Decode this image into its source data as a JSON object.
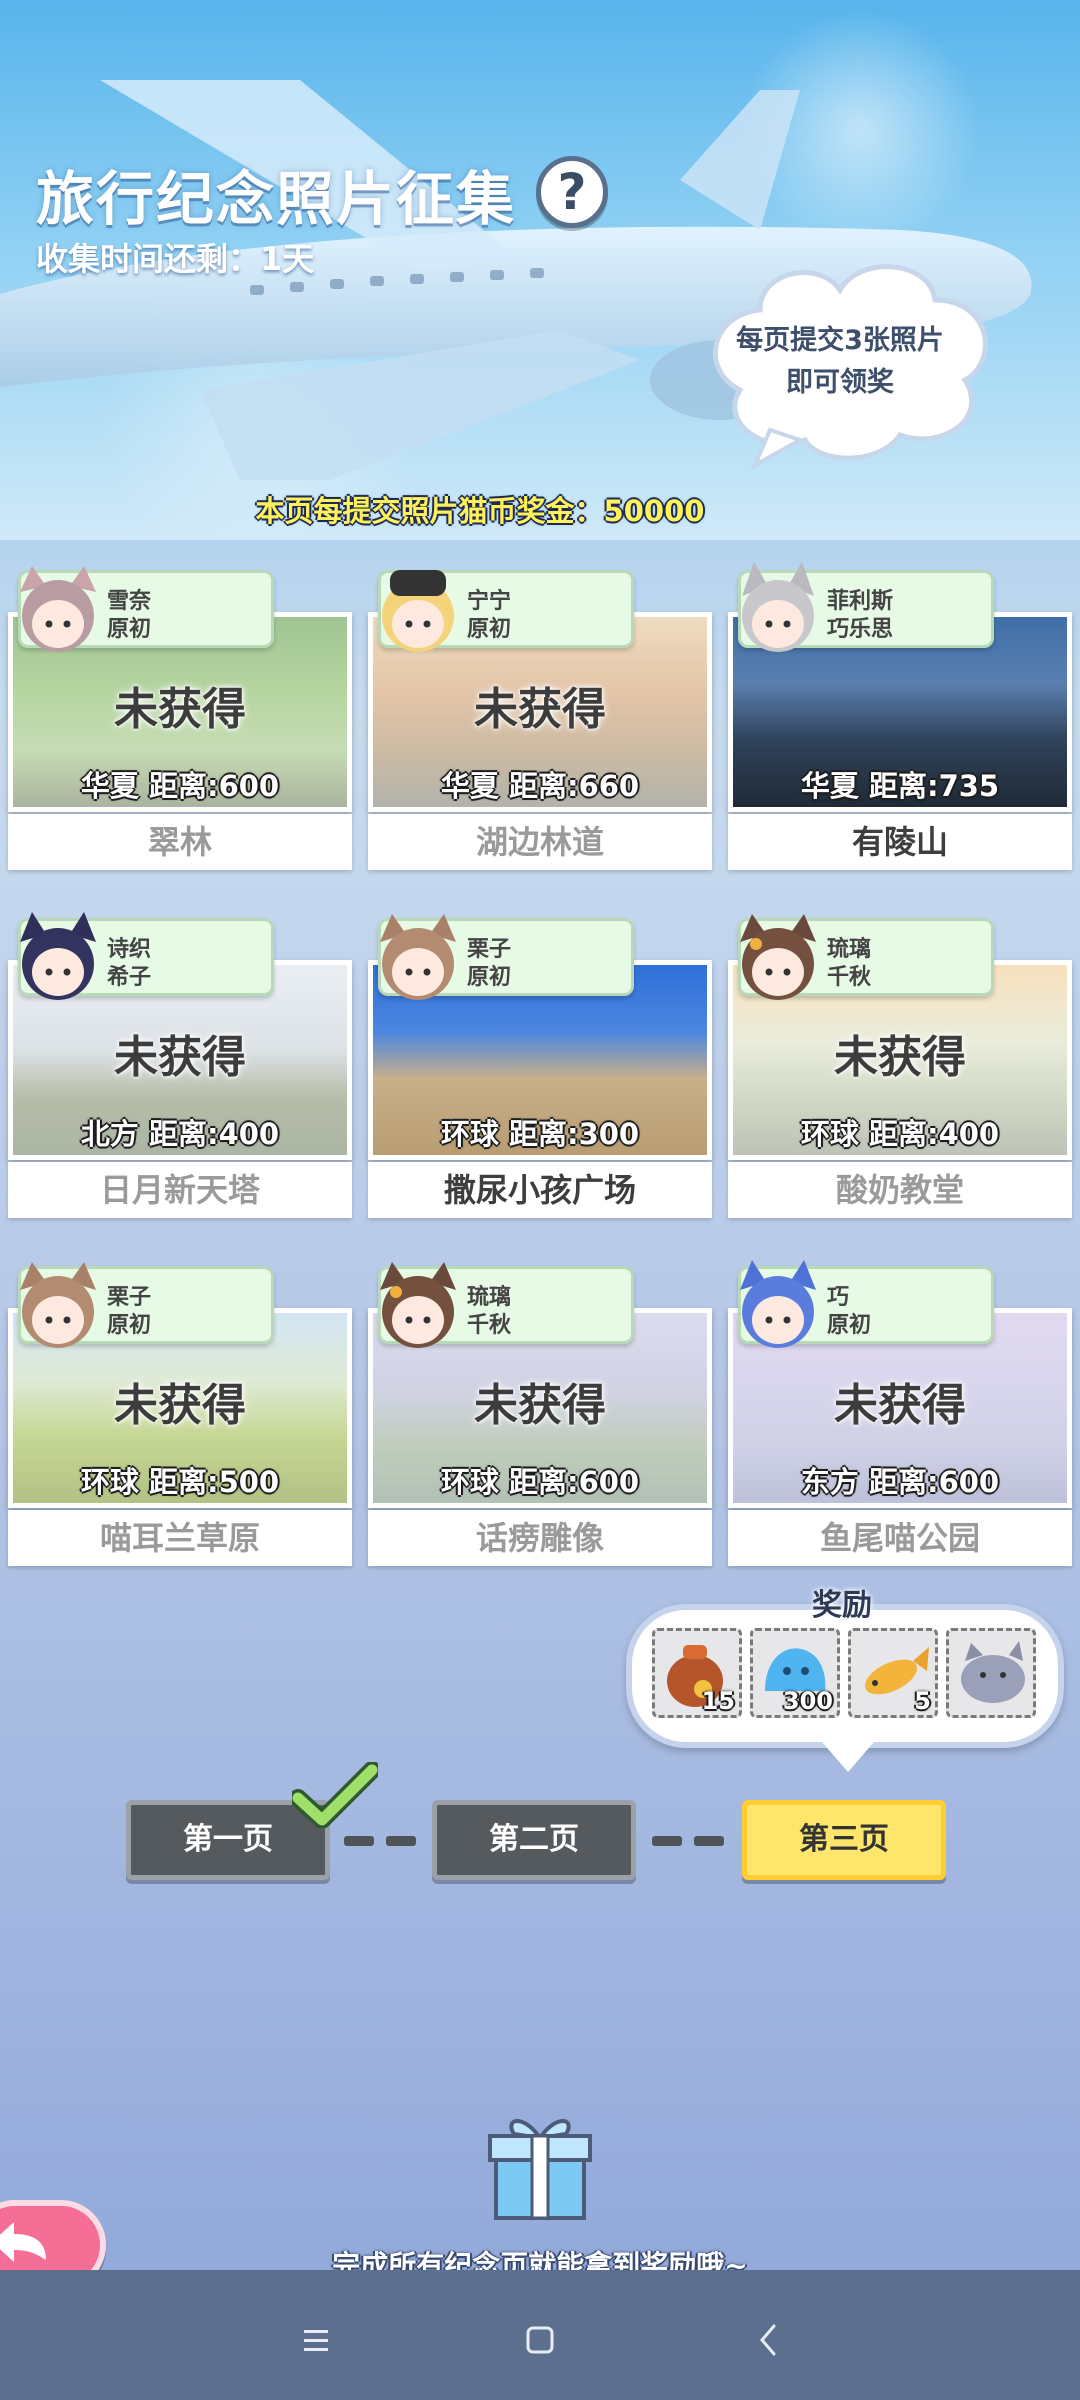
{
  "header": {
    "title": "旅行纪念照片征集",
    "help_symbol": "?",
    "timer": "收集时间还剩：1天",
    "hint_line1": "每页提交3张照片",
    "hint_line2": "即可领奖",
    "bonus": "本页每提交照片猫币奖金：50000"
  },
  "cards": [
    {
      "char": "雪奈",
      "sub": "原初",
      "status": "未获得",
      "distance": "华夏  距离:600",
      "name": "翠林",
      "obtained": false
    },
    {
      "char": "宁宁",
      "sub": "原初",
      "status": "未获得",
      "distance": "华夏  距离:660",
      "name": "湖边林道",
      "obtained": false
    },
    {
      "char": "菲利斯",
      "sub": "巧乐思",
      "status": "",
      "distance": "华夏  距离:735",
      "name": "有陵山",
      "obtained": true
    },
    {
      "char": "诗织",
      "sub": "希子",
      "status": "未获得",
      "distance": "北方  距离:400",
      "name": "日月新天塔",
      "obtained": false
    },
    {
      "char": "栗子",
      "sub": "原初",
      "status": "",
      "distance": "环球  距离:300",
      "name": "撒尿小孩广场",
      "obtained": true
    },
    {
      "char": "琉璃",
      "sub": "千秋",
      "status": "未获得",
      "distance": "环球  距离:400",
      "name": "酸奶教堂",
      "obtained": false
    },
    {
      "char": "栗子",
      "sub": "原初",
      "status": "未获得",
      "distance": "环球  距离:500",
      "name": "喵耳兰草原",
      "obtained": false
    },
    {
      "char": "琉璃",
      "sub": "千秋",
      "status": "未获得",
      "distance": "环球  距离:600",
      "name": "话痨雕像",
      "obtained": false
    },
    {
      "char": "巧",
      "sub": "原初",
      "status": "未获得",
      "distance": "东方  距离:600",
      "name": "鱼尾喵公园",
      "obtained": false
    }
  ],
  "reward": {
    "title": "奖励",
    "items": [
      {
        "icon": "treasure-bag-icon",
        "count": "15"
      },
      {
        "icon": "blue-slime-icon",
        "count": "300"
      },
      {
        "icon": "golden-fish-icon",
        "count": "5"
      },
      {
        "icon": "grey-cat-icon",
        "count": ""
      }
    ]
  },
  "pages": [
    {
      "label": "第一页",
      "state": "completed"
    },
    {
      "label": "第二页",
      "state": "normal"
    },
    {
      "label": "第三页",
      "state": "active"
    }
  ],
  "footer": {
    "text": "完成所有纪念页就能拿到奖励哦~"
  },
  "colors": {
    "active_page": "#fde66b",
    "page_button": "#555a5e",
    "back_button": "#f46e96",
    "tag_bg": "#e6fae6",
    "navbar": "#5c6f8f"
  }
}
